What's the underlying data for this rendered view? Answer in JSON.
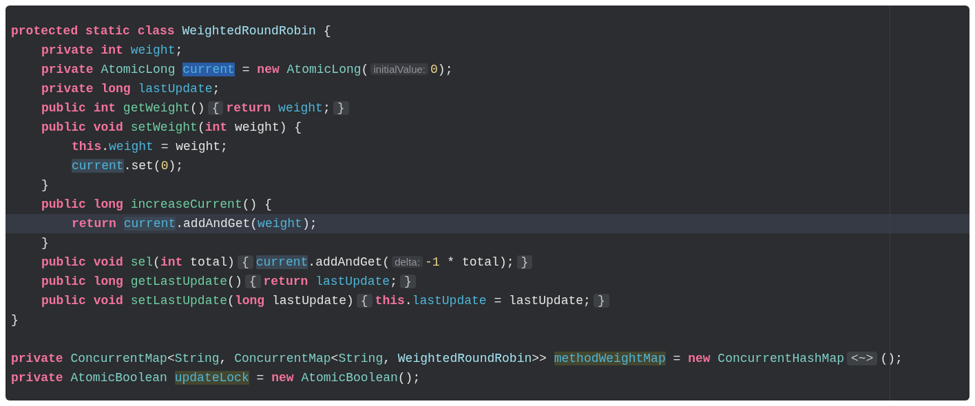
{
  "editor": {
    "lines": [
      {
        "kind": "code",
        "current": false,
        "tokens": [
          {
            "kind": "keyword",
            "text": "protected",
            "space": true
          },
          {
            "kind": "keyword",
            "text": "static",
            "space": true
          },
          {
            "kind": "keyword",
            "text": "class",
            "space": true
          },
          {
            "kind": "class",
            "text": "WeightedRoundRobin",
            "space": true
          },
          {
            "kind": "plain",
            "text": "{"
          }
        ],
        "children": [
          {
            "kind": "code",
            "current": false,
            "tokens": [
              {
                "kind": "keyword",
                "text": "private",
                "space": true
              },
              {
                "kind": "keyword",
                "text": "int",
                "space": true
              },
              {
                "kind": "field",
                "text": "weight"
              },
              {
                "kind": "plain",
                "text": ";"
              }
            ]
          },
          {
            "kind": "code",
            "current": false,
            "tokens": [
              {
                "kind": "keyword",
                "text": "private",
                "space": true
              },
              {
                "kind": "type",
                "text": "AtomicLong",
                "space": true
              },
              {
                "kind": "field",
                "text": "current",
                "color": "#2a5ca8",
                "space": true
              },
              {
                "kind": "plain",
                "text": "=",
                "space": true
              },
              {
                "kind": "keyword",
                "text": "new",
                "space": true
              },
              {
                "kind": "type",
                "text": "AtomicLong"
              },
              {
                "kind": "plain",
                "text": "("
              },
              {
                "kind": "hint",
                "text": "initialValue:"
              },
              {
                "kind": "number",
                "text": "0"
              },
              {
                "kind": "plain",
                "text": ");"
              }
            ]
          },
          {
            "kind": "code",
            "current": false,
            "tokens": [
              {
                "kind": "keyword",
                "text": "private",
                "space": true
              },
              {
                "kind": "keyword",
                "text": "long",
                "space": true
              },
              {
                "kind": "field",
                "text": "lastUpdate"
              },
              {
                "kind": "plain",
                "text": ";"
              }
            ]
          },
          {
            "kind": "code",
            "current": false,
            "tokens": [
              {
                "kind": "keyword",
                "text": "public",
                "space": true
              },
              {
                "kind": "keyword",
                "text": "int",
                "space": true
              },
              {
                "kind": "method",
                "text": "getWeight"
              },
              {
                "kind": "plain",
                "text": "()"
              },
              {
                "kind": "fold",
                "text": "{"
              },
              {
                "kind": "keyword",
                "text": "return",
                "space": true
              },
              {
                "kind": "field",
                "text": "weight"
              },
              {
                "kind": "plain",
                "text": ";"
              },
              {
                "kind": "fold",
                "text": "}"
              }
            ]
          },
          {
            "kind": "code",
            "current": false,
            "tokens": [
              {
                "kind": "keyword",
                "text": "public",
                "space": true
              },
              {
                "kind": "keyword",
                "text": "void",
                "space": true
              },
              {
                "kind": "method",
                "text": "setWeight"
              },
              {
                "kind": "plain",
                "text": "("
              },
              {
                "kind": "keyword",
                "text": "int",
                "space": true
              },
              {
                "kind": "plain",
                "text": "weight) {"
              }
            ],
            "children": [
              {
                "kind": "code",
                "current": false,
                "tokens": [
                  {
                    "kind": "keyword",
                    "text": "this"
                  },
                  {
                    "kind": "plain",
                    "text": "."
                  },
                  {
                    "kind": "field",
                    "text": "weight",
                    "space": true
                  },
                  {
                    "kind": "plain",
                    "text": "= weight;"
                  }
                ]
              },
              {
                "kind": "code",
                "current": false,
                "tokens": [
                  {
                    "kind": "field",
                    "text": "current",
                    "color": "#3b4754"
                  },
                  {
                    "kind": "plain",
                    "text": ".set("
                  },
                  {
                    "kind": "number",
                    "text": "0"
                  },
                  {
                    "kind": "plain",
                    "text": ");"
                  }
                ]
              }
            ]
          },
          {
            "kind": "code",
            "current": false,
            "tokens": [
              {
                "kind": "plain",
                "text": "}"
              }
            ]
          },
          {
            "kind": "code",
            "current": false,
            "tokens": [
              {
                "kind": "keyword",
                "text": "public",
                "space": true
              },
              {
                "kind": "keyword",
                "text": "long",
                "space": true
              },
              {
                "kind": "method",
                "text": "increaseCurrent"
              },
              {
                "kind": "plain",
                "text": "() {"
              }
            ],
            "children": [
              {
                "kind": "code",
                "current": true,
                "tokens": [
                  {
                    "kind": "keyword",
                    "text": "return",
                    "space": true
                  },
                  {
                    "kind": "field",
                    "text": "current",
                    "color": "#3b4754"
                  },
                  {
                    "kind": "plain",
                    "text": ".addAndGet("
                  },
                  {
                    "kind": "field",
                    "text": "weight"
                  },
                  {
                    "kind": "plain",
                    "text": ");"
                  }
                ]
              }
            ]
          },
          {
            "kind": "code",
            "current": false,
            "tokens": [
              {
                "kind": "plain",
                "text": "}"
              }
            ]
          },
          {
            "kind": "code",
            "current": false,
            "tokens": [
              {
                "kind": "keyword",
                "text": "public",
                "space": true
              },
              {
                "kind": "keyword",
                "text": "void",
                "space": true
              },
              {
                "kind": "method",
                "text": "sel"
              },
              {
                "kind": "plain",
                "text": "("
              },
              {
                "kind": "keyword",
                "text": "int",
                "space": true
              },
              {
                "kind": "plain",
                "text": "total)"
              },
              {
                "kind": "fold",
                "text": "{"
              },
              {
                "kind": "field",
                "text": "current",
                "color": "#3b4754"
              },
              {
                "kind": "plain",
                "text": ".addAndGet("
              },
              {
                "kind": "hint",
                "text": "delta:"
              },
              {
                "kind": "number",
                "text": "-1",
                "space": true
              },
              {
                "kind": "plain",
                "text": "* total);"
              },
              {
                "kind": "fold",
                "text": "}"
              }
            ]
          },
          {
            "kind": "code",
            "current": false,
            "tokens": [
              {
                "kind": "keyword",
                "text": "public",
                "space": true
              },
              {
                "kind": "keyword",
                "text": "long",
                "space": true
              },
              {
                "kind": "method",
                "text": "getLastUpdate"
              },
              {
                "kind": "plain",
                "text": "()"
              },
              {
                "kind": "fold",
                "text": "{"
              },
              {
                "kind": "keyword",
                "text": "return",
                "space": true
              },
              {
                "kind": "field",
                "text": "lastUpdate"
              },
              {
                "kind": "plain",
                "text": ";"
              },
              {
                "kind": "fold",
                "text": "}"
              }
            ]
          },
          {
            "kind": "code",
            "current": false,
            "tokens": [
              {
                "kind": "keyword",
                "text": "public",
                "space": true
              },
              {
                "kind": "keyword",
                "text": "void",
                "space": true
              },
              {
                "kind": "method",
                "text": "setLastUpdate"
              },
              {
                "kind": "plain",
                "text": "("
              },
              {
                "kind": "keyword",
                "text": "long",
                "space": true
              },
              {
                "kind": "plain",
                "text": "lastUpdate)"
              },
              {
                "kind": "fold",
                "text": "{"
              },
              {
                "kind": "keyword",
                "text": "this"
              },
              {
                "kind": "plain",
                "text": "."
              },
              {
                "kind": "field",
                "text": "lastUpdate",
                "space": true
              },
              {
                "kind": "plain",
                "text": "= lastUpdate;"
              },
              {
                "kind": "fold",
                "text": "}"
              }
            ]
          }
        ]
      },
      {
        "kind": "code",
        "current": false,
        "tokens": [
          {
            "kind": "plain",
            "text": "}"
          }
        ]
      },
      {
        "kind": "blank",
        "current": false
      },
      {
        "kind": "code",
        "current": false,
        "tokens": [
          {
            "kind": "keyword",
            "text": "private",
            "space": true
          },
          {
            "kind": "type",
            "text": "ConcurrentMap"
          },
          {
            "kind": "plain",
            "text": "<"
          },
          {
            "kind": "type",
            "text": "String"
          },
          {
            "kind": "plain",
            "text": ",",
            "space": true
          },
          {
            "kind": "type",
            "text": "ConcurrentMap"
          },
          {
            "kind": "plain",
            "text": "<"
          },
          {
            "kind": "type",
            "text": "String"
          },
          {
            "kind": "plain",
            "text": ",",
            "space": true
          },
          {
            "kind": "class",
            "text": "WeightedRoundRobin"
          },
          {
            "kind": "plain",
            "text": ">>",
            "space": true
          },
          {
            "kind": "field",
            "text": "methodWeightMap",
            "color": "#44472f",
            "space": true
          },
          {
            "kind": "plain",
            "text": "=",
            "space": true
          },
          {
            "kind": "keyword",
            "text": "new",
            "space": true
          },
          {
            "kind": "type",
            "text": "ConcurrentHashMap"
          },
          {
            "kind": "fold",
            "text": "<~>"
          },
          {
            "kind": "plain",
            "text": "();"
          }
        ]
      },
      {
        "kind": "code",
        "current": false,
        "tokens": [
          {
            "kind": "keyword",
            "text": "private",
            "space": true
          },
          {
            "kind": "type",
            "text": "AtomicBoolean",
            "space": true
          },
          {
            "kind": "field",
            "text": "updateLock",
            "color": "#44472f",
            "space": true
          },
          {
            "kind": "plain",
            "text": "=",
            "space": true
          },
          {
            "kind": "keyword",
            "text": "new",
            "space": true
          },
          {
            "kind": "type",
            "text": "AtomicBoolean"
          },
          {
            "kind": "plain",
            "text": "();"
          }
        ]
      }
    ]
  }
}
